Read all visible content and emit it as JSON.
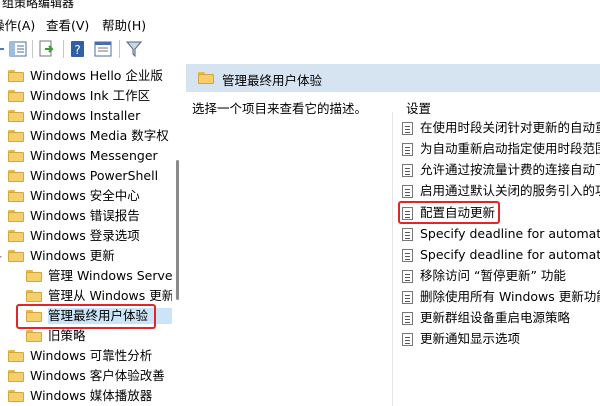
{
  "window": {
    "title": "组策略编辑器"
  },
  "menu": {
    "action": "操作(A)",
    "view": "查看(V)",
    "help": "帮助(H)"
  },
  "tree": {
    "items": [
      {
        "label": "Windows Hello 企业版"
      },
      {
        "label": "Windows Ink 工作区"
      },
      {
        "label": "Windows Installer"
      },
      {
        "label": "Windows Media 数字权"
      },
      {
        "label": "Windows Messenger"
      },
      {
        "label": "Windows PowerShell"
      },
      {
        "label": "Windows 安全中心"
      },
      {
        "label": "Windows 错误报告"
      },
      {
        "label": "Windows 登录选项"
      },
      {
        "label": "Windows 更新"
      },
      {
        "label": "管理 Windows Serve"
      },
      {
        "label": "管理从 Windows 更新"
      },
      {
        "label": "管理最终用户体验"
      },
      {
        "label": "旧策略"
      },
      {
        "label": "Windows 可靠性分析"
      },
      {
        "label": "Windows 客户体验改善"
      },
      {
        "label": "Windows 媒体播放器"
      }
    ]
  },
  "details": {
    "header_title": "管理最终用户体验",
    "description": "选择一个项目来查看它的描述。",
    "column_header": "设置",
    "settings": [
      {
        "label": "在使用时段关闭针对更新的自动重"
      },
      {
        "label": "为自动重新启动指定使用时段范围"
      },
      {
        "label": "允许通过按流量计费的连接自动下"
      },
      {
        "label": "启用通过默认关闭的服务引入的功"
      },
      {
        "label": "配置自动更新"
      },
      {
        "label": "Specify deadline for automatic"
      },
      {
        "label": "Specify deadline for automatic"
      },
      {
        "label": "移除访问 “暂停更新” 功能"
      },
      {
        "label": "删除使用所有 Windows 更新功能"
      },
      {
        "label": "更新群组设备重启电源策略"
      },
      {
        "label": "更新通知显示选项"
      }
    ]
  },
  "colors": {
    "header_bg": "#d6e4f2",
    "highlight_box": "#e0262b",
    "selection_bg": "#cce4f7"
  }
}
